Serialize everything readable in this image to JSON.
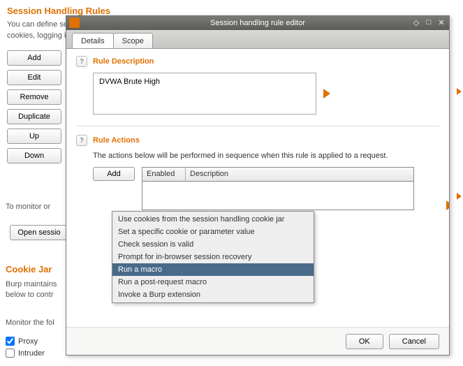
{
  "bg": {
    "heading": "Session Handling Rules",
    "desc1": "You can define session handling rules to make Burp perform specific actions when making HTTP requests. Each ru",
    "desc2": "cookies, logging in, and so on.",
    "buttons": {
      "add": "Add",
      "edit": "Edit",
      "remove": "Remove",
      "duplicate": "Duplicate",
      "up": "Up",
      "down": "Down"
    },
    "monitor": "To monitor or",
    "open_sessions": "Open sessio",
    "jar_heading": "Cookie Jar",
    "jar_text1": "Burp maintains",
    "jar_text2": "below to contr",
    "monitor_following": "Monitor the fol",
    "chk_proxy": "Proxy",
    "chk_intruder": "Intruder"
  },
  "dialog": {
    "title": "Session handling rule editor",
    "tabs": {
      "details": "Details",
      "scope": "Scope"
    },
    "rule_desc_heading": "Rule Description",
    "rule_desc_value": "DVWA Brute High",
    "rule_actions_heading": "Rule Actions",
    "rule_actions_text": "The actions below will be performed in sequence when this rule is applied to a request.",
    "add_btn": "Add",
    "col_enabled": "Enabled",
    "col_description": "Description",
    "footer": {
      "ok": "OK",
      "cancel": "Cancel"
    }
  },
  "menu": {
    "items": [
      "Use cookies from the session handling cookie jar",
      "Set a specific cookie or parameter value",
      "Check session is valid",
      "Prompt for in-browser session recovery",
      "Run a macro",
      "Run a post-request macro",
      "Invoke a Burp extension"
    ],
    "selected_index": 4
  }
}
